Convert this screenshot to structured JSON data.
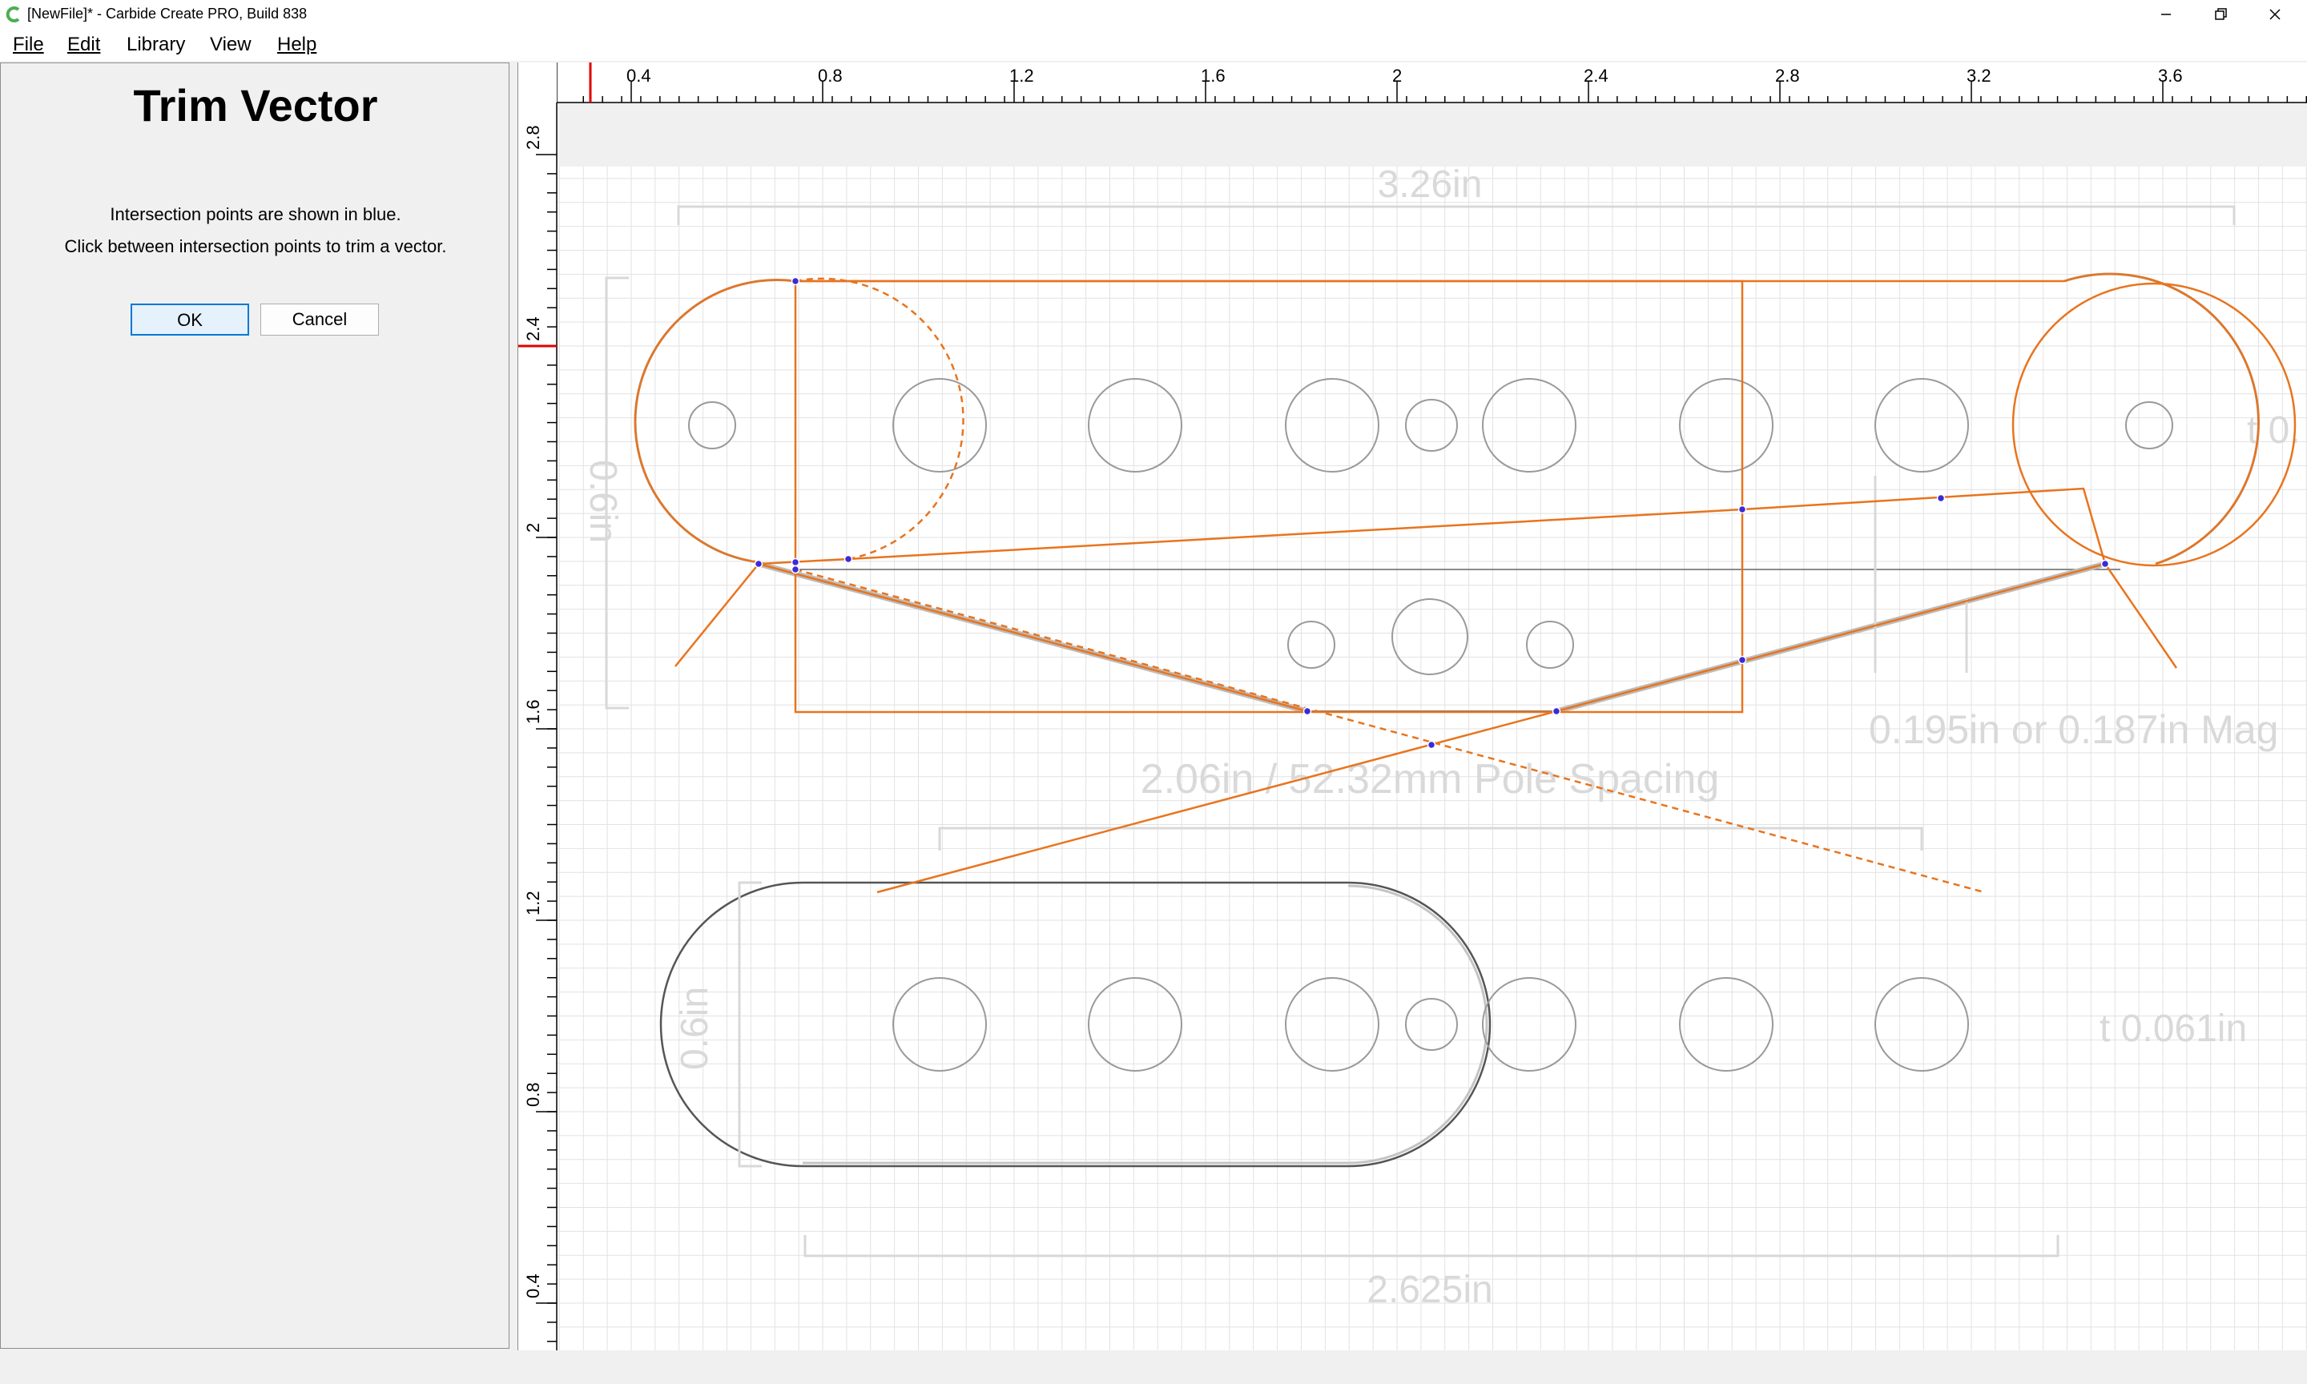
{
  "window": {
    "title": "[NewFile]* - Carbide Create PRO, Build 838",
    "icons": {
      "app": "carbide-c-icon",
      "minimize": "minimize-icon",
      "maximize": "restore-icon",
      "close": "close-icon"
    },
    "accent_color": "#4caf50"
  },
  "menu": {
    "file": "File",
    "edit": "Edit",
    "library": "Library",
    "view": "View",
    "help": "Help"
  },
  "panel": {
    "title": "Trim Vector",
    "line1": "Intersection points are shown in blue.",
    "line2": "Click between intersection points to trim a vector.",
    "ok": "OK",
    "cancel": "Cancel"
  },
  "rulers": {
    "top_ticks": [
      "0.4",
      "0.8",
      "1.2",
      "1.6",
      "2",
      "2.4",
      "2.8",
      "3.2",
      "3.6"
    ],
    "left_ticks": [
      "2.8",
      "2.4",
      "2",
      "1.6",
      "1.2",
      "0.8",
      "0.4"
    ]
  },
  "drawing": {
    "dim_top": "3.26in",
    "dim_left_top": "0.6in",
    "dim_right_top": "t 0.",
    "dim_pole_spacing": "2.06in / 52.32mm Pole Spacing",
    "dim_magnet": "0.195in or 0.187in Mag",
    "dim_left_bottom": "0.6in",
    "dim_right_bottom": "t 0.061in",
    "dim_bottom": "2.625in",
    "colors": {
      "vector": "#e8741e",
      "intersection": "#3a2bd8",
      "guide": "#8a8a8a",
      "grid": "#dcdcdc",
      "dimension_text": "#d9d9d9"
    }
  }
}
